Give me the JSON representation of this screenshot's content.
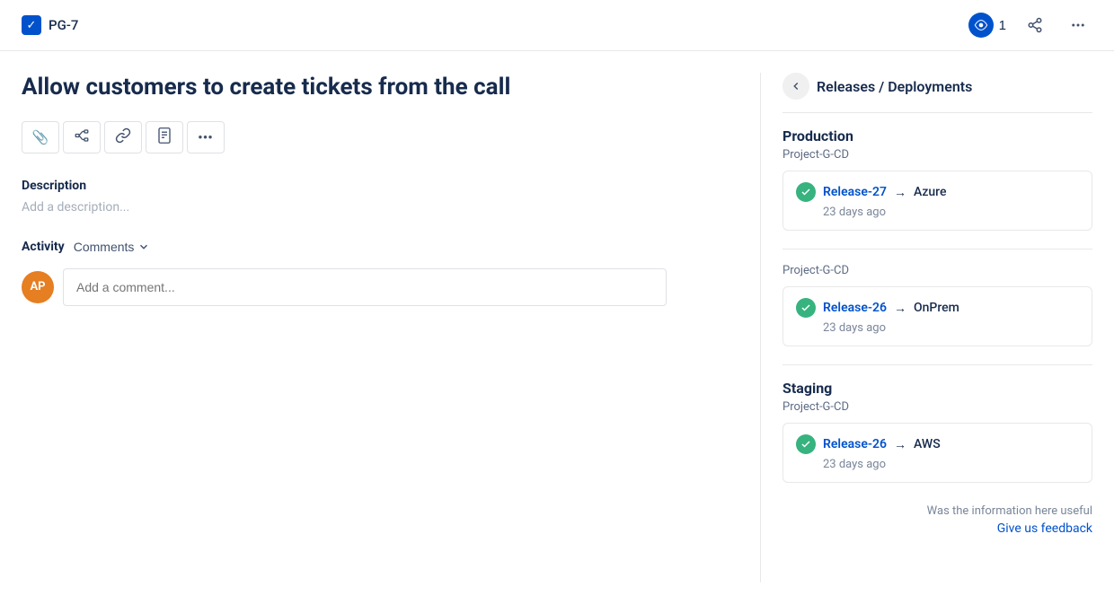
{
  "header": {
    "ticket_id": "PG-7",
    "checkbox_icon": "✓",
    "watch_count": "1",
    "share_icon": "share",
    "more_icon": "more"
  },
  "ticket": {
    "title": "Allow customers to create tickets from the call"
  },
  "toolbar": {
    "attach_label": "📎",
    "diagram_label": "⠿",
    "link_label": "🔗",
    "document_label": "📄",
    "more_label": "•••"
  },
  "description": {
    "label": "Description",
    "placeholder": "Add a description..."
  },
  "activity": {
    "label": "Activity",
    "comments_label": "Comments",
    "comment_placeholder": "Add a comment...",
    "avatar_initials": "AP"
  },
  "releases_panel": {
    "back_label": "←",
    "title": "Releases / Deployments",
    "environments": [
      {
        "name": "Production",
        "project": "Project-G-CD",
        "releases": [
          {
            "name": "Release-27",
            "target": "Azure",
            "time": "23 days ago"
          }
        ]
      },
      {
        "name": "",
        "project": "Project-G-CD",
        "releases": [
          {
            "name": "Release-26",
            "target": "OnPrem",
            "time": "23 days ago"
          }
        ]
      },
      {
        "name": "Staging",
        "project": "Project-G-CD",
        "releases": [
          {
            "name": "Release-26",
            "target": "AWS",
            "time": "23 days ago"
          }
        ]
      }
    ],
    "feedback_text": "Was the information here useful",
    "feedback_link": "Give us feedback"
  },
  "colors": {
    "accent": "#0052cc",
    "success": "#36b37e",
    "text_primary": "#172b4d",
    "text_secondary": "#5e6c84",
    "border": "#e8e8e8"
  }
}
